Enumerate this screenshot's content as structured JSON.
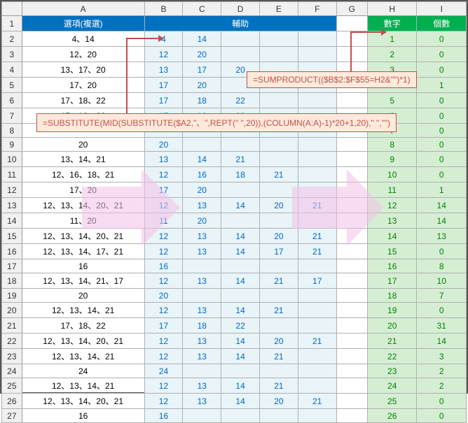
{
  "columns": [
    "A",
    "B",
    "C",
    "D",
    "E",
    "F",
    "G",
    "H",
    "I"
  ],
  "hdr_a": "選項(複選)",
  "hdr_bf": "輔助",
  "hdr_h": "數字",
  "hdr_i": "個數",
  "formula1": "=SUMPRODUCT(($B$2:$F$55=H2&\"\")*1)",
  "formula2": "=SUBSTITUTE(MID(SUBSTITUTE($A2,\"、\",REPT(\" \",20)),(COLUMN(A:A)-1)*20+1,20),\" \",\"\")",
  "rows": [
    {
      "n": 2,
      "a": "4、14",
      "b": [
        "4",
        "14",
        "",
        "",
        ""
      ],
      "h": "1",
      "i": "0"
    },
    {
      "n": 3,
      "a": "12、20",
      "b": [
        "12",
        "20",
        "",
        "",
        ""
      ],
      "h": "2",
      "i": "0"
    },
    {
      "n": 4,
      "a": "13、17、20",
      "b": [
        "13",
        "17",
        "20",
        "",
        ""
      ],
      "h": "3",
      "i": "0"
    },
    {
      "n": 5,
      "a": "17、20",
      "b": [
        "17",
        "20",
        "",
        "",
        ""
      ],
      "h": "4",
      "i": "1"
    },
    {
      "n": 6,
      "a": "17、18、22",
      "b": [
        "17",
        "18",
        "22",
        "",
        ""
      ],
      "h": "5",
      "i": "0"
    },
    {
      "n": 7,
      "a": "17、18、23",
      "b": [
        "17",
        "18",
        "23",
        "",
        ""
      ],
      "h": "6",
      "i": "0"
    },
    {
      "n": 8,
      "a": "",
      "b": [
        "",
        "",
        "",
        "",
        ""
      ],
      "h": "7",
      "i": "0"
    },
    {
      "n": 9,
      "a": "20",
      "b": [
        "20",
        "",
        "",
        "",
        ""
      ],
      "h": "8",
      "i": "0"
    },
    {
      "n": 10,
      "a": "13、14、21",
      "b": [
        "13",
        "14",
        "21",
        "",
        ""
      ],
      "h": "9",
      "i": "0"
    },
    {
      "n": 11,
      "a": "12、16、18、21",
      "b": [
        "12",
        "16",
        "18",
        "21",
        ""
      ],
      "h": "10",
      "i": "0"
    },
    {
      "n": 12,
      "a": "17、20",
      "b": [
        "17",
        "20",
        "",
        "",
        ""
      ],
      "h": "11",
      "i": "1"
    },
    {
      "n": 13,
      "a": "12、13、14、20、21",
      "b": [
        "12",
        "13",
        "14",
        "20",
        "21"
      ],
      "h": "12",
      "i": "14"
    },
    {
      "n": 14,
      "a": "11、20",
      "b": [
        "11",
        "20",
        "",
        "",
        ""
      ],
      "h": "13",
      "i": "14"
    },
    {
      "n": 15,
      "a": "12、13、14、20、21",
      "b": [
        "12",
        "13",
        "14",
        "20",
        "21"
      ],
      "h": "14",
      "i": "13"
    },
    {
      "n": 16,
      "a": "12、13、14、17、21",
      "b": [
        "12",
        "13",
        "14",
        "17",
        "21"
      ],
      "h": "15",
      "i": "0"
    },
    {
      "n": 17,
      "a": "16",
      "b": [
        "16",
        "",
        "",
        "",
        ""
      ],
      "h": "16",
      "i": "8"
    },
    {
      "n": 18,
      "a": "12、13、14、21、17",
      "b": [
        "12",
        "13",
        "14",
        "21",
        "17"
      ],
      "h": "17",
      "i": "10"
    },
    {
      "n": 19,
      "a": "20",
      "b": [
        "20",
        "",
        "",
        "",
        ""
      ],
      "h": "18",
      "i": "7"
    },
    {
      "n": 20,
      "a": "12、13、14、21",
      "b": [
        "12",
        "13",
        "14",
        "21",
        ""
      ],
      "h": "19",
      "i": "0"
    },
    {
      "n": 21,
      "a": "17、18、22",
      "b": [
        "17",
        "18",
        "22",
        "",
        ""
      ],
      "h": "20",
      "i": "31"
    },
    {
      "n": 22,
      "a": "12、13、14、20、21",
      "b": [
        "12",
        "13",
        "14",
        "20",
        "21"
      ],
      "h": "21",
      "i": "14"
    },
    {
      "n": 23,
      "a": "12、13、14、21",
      "b": [
        "12",
        "13",
        "14",
        "21",
        ""
      ],
      "h": "22",
      "i": "3"
    },
    {
      "n": 24,
      "a": "24",
      "b": [
        "24",
        "",
        "",
        "",
        ""
      ],
      "h": "23",
      "i": "2"
    },
    {
      "n": 25,
      "a": "12、13、14、21",
      "b": [
        "12",
        "13",
        "14",
        "21",
        ""
      ],
      "h": "24",
      "i": "2"
    },
    {
      "n": 26,
      "a": "12、13、14、20、21",
      "b": [
        "12",
        "13",
        "14",
        "20",
        "21"
      ],
      "h": "25",
      "i": "0"
    },
    {
      "n": 27,
      "a": "16",
      "b": [
        "16",
        "",
        "",
        "",
        ""
      ],
      "h": "26",
      "i": "0"
    }
  ]
}
